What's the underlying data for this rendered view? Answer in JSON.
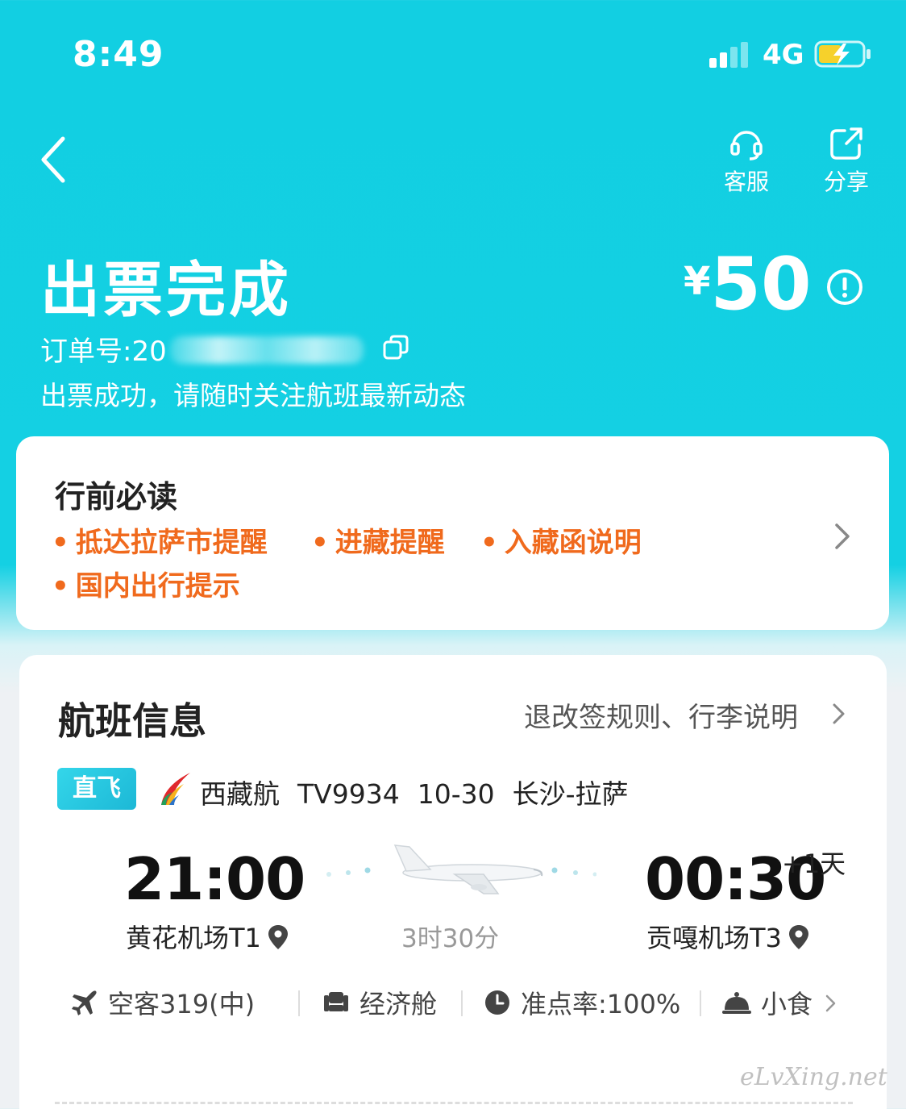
{
  "status_bar": {
    "time": "8:49",
    "network": "4G"
  },
  "header": {
    "customer_service_label": "客服",
    "share_label": "分享"
  },
  "order": {
    "status_title": "出票完成",
    "price_currency": "¥",
    "price_amount": "50",
    "order_number_prefix": "订单号:20",
    "subtitle": "出票成功，请随时关注航班最新动态"
  },
  "pre_trip": {
    "heading": "行前必读",
    "tips": [
      "抵达拉萨市提醒",
      "进藏提醒",
      "入藏函说明",
      "国内出行提示"
    ]
  },
  "flight": {
    "heading": "航班信息",
    "rules_link": "退改签规则、行李说明",
    "badge": "直飞",
    "airline": "西藏航",
    "flight_no": "TV9934",
    "date": "10-30",
    "route": "长沙-拉萨",
    "dep_time": "21:00",
    "dep_airport": "黄花机场T1",
    "arr_time": "00:30",
    "arr_day_offset": "+1天",
    "arr_airport": "贡嘎机场T3",
    "duration": "3时30分",
    "aircraft": "空客319(中)",
    "cabin": "经济舱",
    "on_time_rate": "准点率:100%",
    "meal": "小食"
  },
  "watermark": "eLvXing.net",
  "colors": {
    "brand": "#12cfe2",
    "tip_orange": "#f06a1d"
  },
  "icons": [
    "back-icon",
    "headset-icon",
    "share-icon",
    "info-icon",
    "copy-icon",
    "chevron-right-icon",
    "airline-logo",
    "plane-icon",
    "location-pin-icon",
    "airplane-icon",
    "seat-icon",
    "clock-icon",
    "meal-icon"
  ]
}
